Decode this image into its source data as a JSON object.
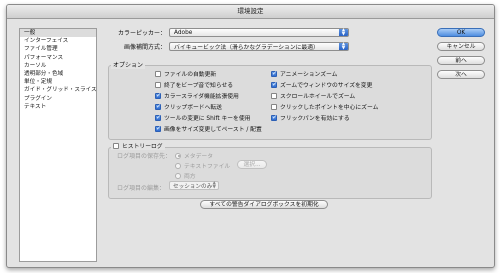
{
  "window": {
    "title": "環境設定"
  },
  "sidebar": {
    "items": [
      {
        "label": "一般",
        "selected": true
      },
      {
        "label": "インターフェイス"
      },
      {
        "label": "ファイル管理"
      },
      {
        "label": "パフォーマンス"
      },
      {
        "label": "カーソル"
      },
      {
        "label": "透明部分・色域"
      },
      {
        "label": "単位・定規"
      },
      {
        "label": "ガイド・グリッド・スライス"
      },
      {
        "label": "プラグイン"
      },
      {
        "label": "テキスト"
      }
    ]
  },
  "general": {
    "color_picker_label": "カラーピッカー：",
    "color_picker_value": "Adobe",
    "interp_label": "画像補間方式：",
    "interp_value": "バイキュービック法（滑らかなグラデーションに最適）"
  },
  "options": {
    "title": "オプション",
    "left": [
      {
        "label": "ファイルの自動更新",
        "checked": false
      },
      {
        "label": "終了をビープ音で知らせる",
        "checked": false
      },
      {
        "label": "カラースライダ機能拡張使用",
        "checked": true
      },
      {
        "label": "クリップボードへ転送",
        "checked": true
      },
      {
        "label": "ツールの変更に Shift キーを使用",
        "checked": true
      },
      {
        "label": "画像をサイズ変更してペースト / 配置",
        "checked": true
      }
    ],
    "right": [
      {
        "label": "アニメーションズーム",
        "checked": true
      },
      {
        "label": "ズームでウィンドウのサイズを変更",
        "checked": true
      },
      {
        "label": "スクロールホイールでズーム",
        "checked": false
      },
      {
        "label": "クリックしたポイントを中心にズーム",
        "checked": false
      },
      {
        "label": "フリックパンを有効にする",
        "checked": true
      }
    ]
  },
  "history": {
    "label": "ヒストリーログ",
    "save_to_label": "ログ項目の保存先：",
    "metadata": "メタデータ",
    "textfile": "テキストファイル",
    "choose_button": "選択...",
    "both": "両方",
    "edit_label": "ログ項目の編集：",
    "edit_value": "セッションのみ"
  },
  "reset_button": "すべての警告ダイアログボックスを初期化",
  "buttons": {
    "ok": "OK",
    "cancel": "キャンセル",
    "prev": "前へ",
    "next": "次へ"
  }
}
